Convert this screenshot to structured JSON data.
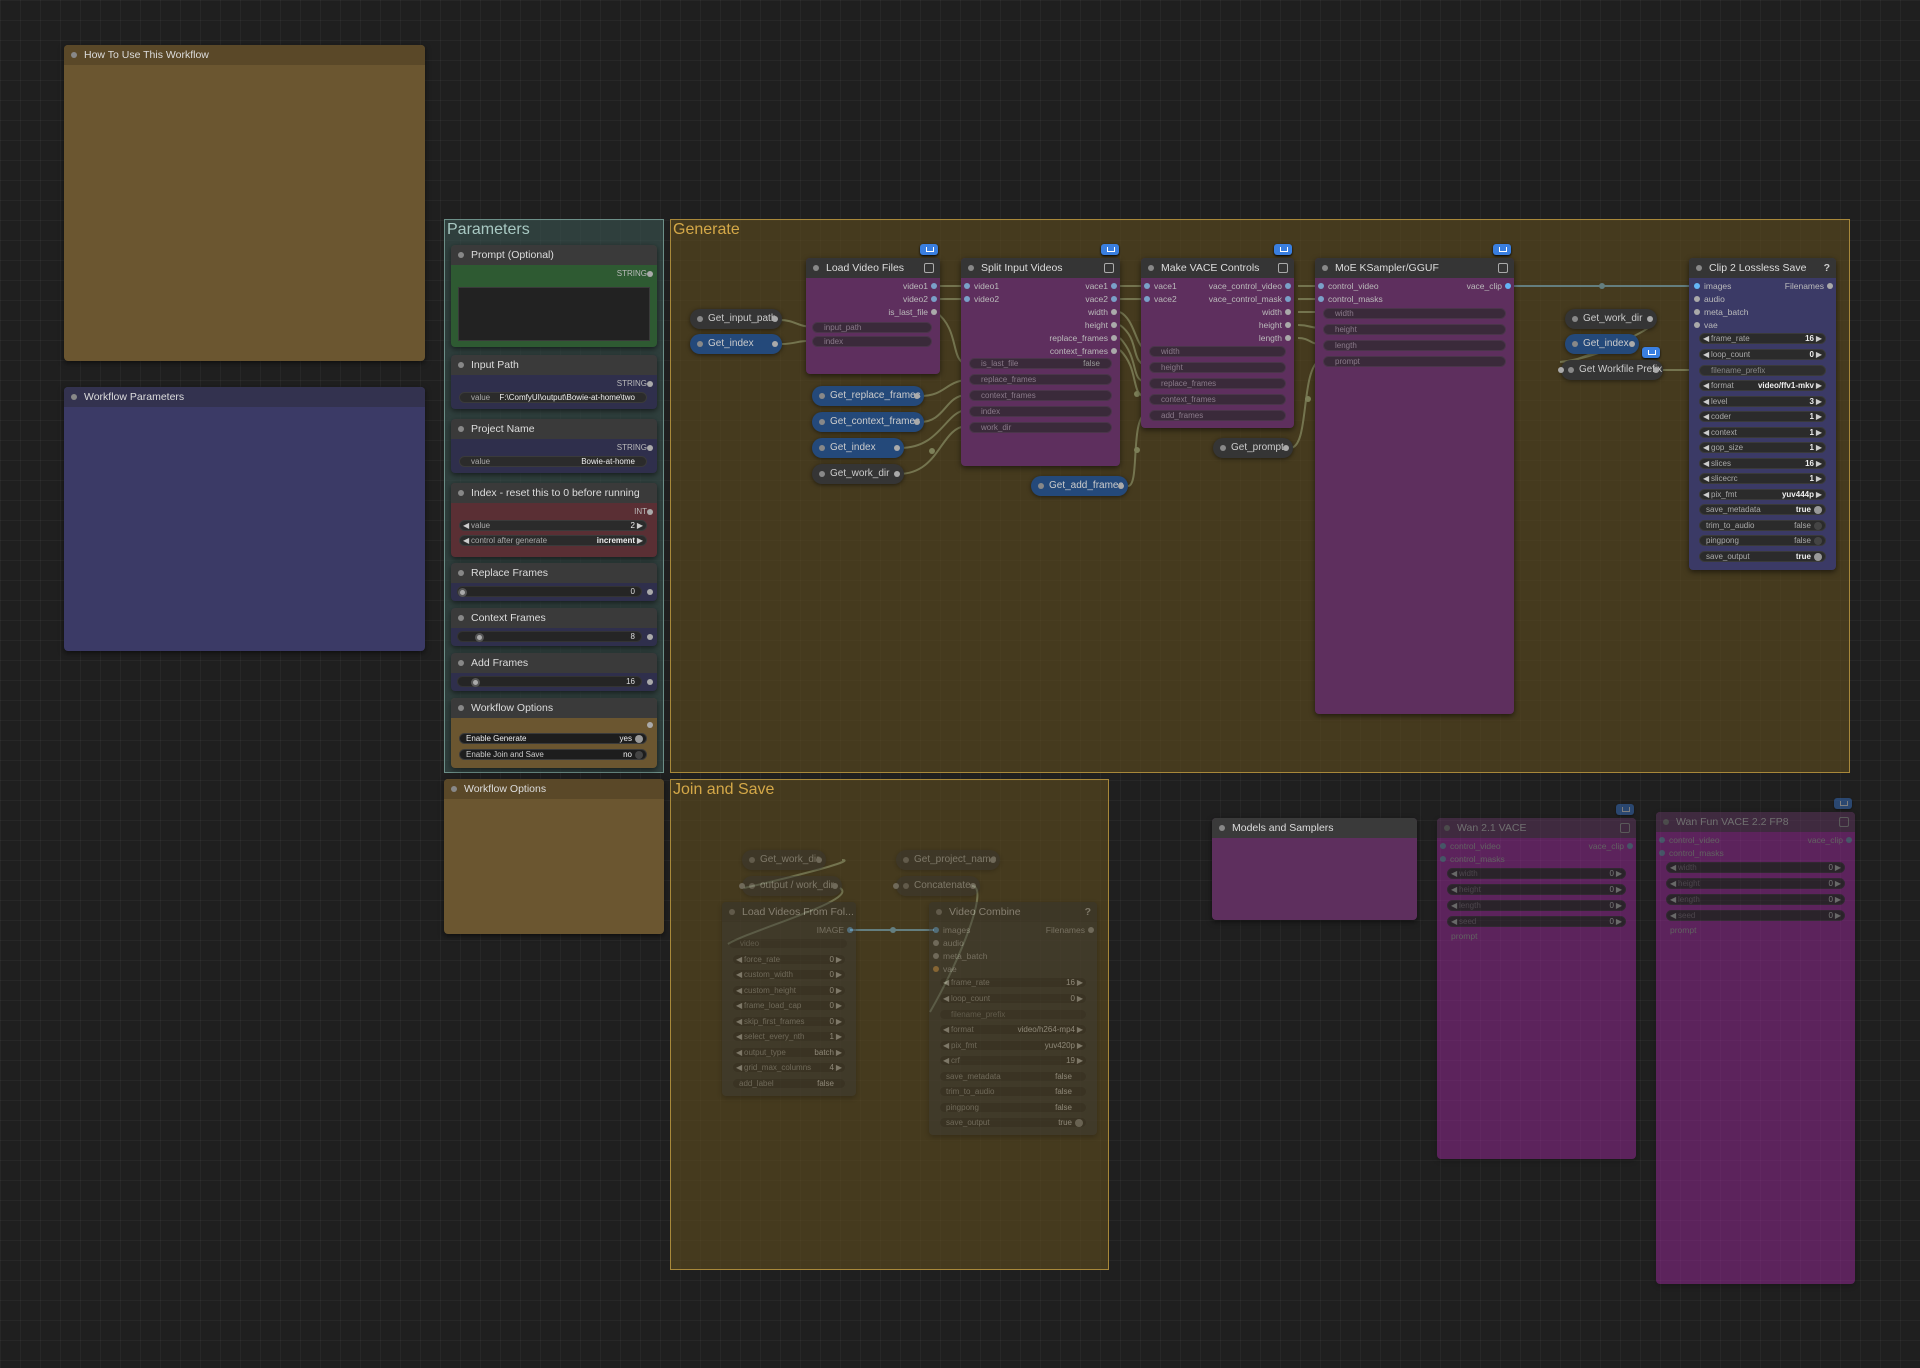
{
  "groups": {
    "parameters": "Parameters",
    "generate": "Generate",
    "join_and_save": "Join and Save"
  },
  "notes": {
    "how_to_use": "How To Use This Workflow",
    "workflow_parameters": "Workflow Parameters",
    "workflow_options_note": "Workflow Options",
    "models_and_samplers": "Models and Samplers"
  },
  "param_nodes": {
    "prompt": {
      "title": "Prompt (Optional)",
      "type": "STRING"
    },
    "input_path": {
      "title": "Input Path",
      "type": "STRING",
      "key": "value",
      "value": "F:\\ComfyUI\\output\\Bowie-at-home\\two"
    },
    "project_name": {
      "title": "Project Name",
      "type": "STRING",
      "key": "value",
      "value": "Bowie-at-home"
    },
    "index": {
      "title": "Index - reset this to 0 before running",
      "type": "INT",
      "key": "value",
      "value": "2",
      "control_key": "control after generate",
      "control_value": "increment"
    },
    "replace_frames": {
      "title": "Replace Frames",
      "value": "0",
      "fraction": 0.0
    },
    "context_frames": {
      "title": "Context Frames",
      "value": "8",
      "fraction": 0.1
    },
    "add_frames": {
      "title": "Add Frames",
      "value": "16",
      "fraction": 0.08
    },
    "workflow_options": {
      "title": "Workflow Options",
      "enable_generate": "Enable Generate",
      "enable_generate_value": "yes",
      "enable_join": "Enable Join and Save",
      "enable_join_value": "no"
    }
  },
  "get_nodes": {
    "input_path": "Get_input_path",
    "index": "Get_index",
    "replace_frames": "Get_replace_frames",
    "context_frames": "Get_context_frames",
    "index2": "Get_index",
    "work_dir": "Get_work_dir",
    "add_frames": "Get_add_frames",
    "prompt": "Get_prompt",
    "work_dir2": "Get_work_dir",
    "index3": "Get_index",
    "workfile_prefix": "Get Workfile Prefix",
    "work_dir3": "Get_work_dir",
    "project_name": "Get_project_name"
  },
  "load_video_files": {
    "title": "Load Video Files",
    "outputs": [
      "video1",
      "video2",
      "is_last_file"
    ],
    "inputs": [
      "input_path",
      "index"
    ]
  },
  "split_input_videos": {
    "title": "Split Input Videos",
    "inputs": [
      "video1",
      "video2"
    ],
    "outputs": [
      "vace1",
      "vace2",
      "width",
      "height",
      "replace_frames",
      "context_frames"
    ],
    "widgets": [
      {
        "k": "is_last_file",
        "v": "false"
      },
      {
        "k": "replace_frames",
        "v": ""
      },
      {
        "k": "context_frames",
        "v": ""
      },
      {
        "k": "index",
        "v": ""
      },
      {
        "k": "work_dir",
        "v": ""
      }
    ]
  },
  "make_vace_controls": {
    "title": "Make VACE Controls",
    "inputs": [
      "vace1",
      "vace2"
    ],
    "outputs": [
      "vace_control_video",
      "vace_control_mask",
      "width",
      "height",
      "length"
    ],
    "widgets": [
      "width",
      "height",
      "replace_frames",
      "context_frames",
      "add_frames"
    ]
  },
  "moe_ksampler": {
    "title": "MoE KSampler/GGUF",
    "inputs": [
      "control_video",
      "control_masks"
    ],
    "output": "vace_clip",
    "widgets": [
      "width",
      "height",
      "length",
      "prompt"
    ]
  },
  "clip_save": {
    "title": "Clip 2 Lossless Save",
    "help": "?",
    "inputs": [
      "images",
      "audio",
      "meta_batch",
      "vae"
    ],
    "output": "Filenames",
    "widgets": [
      {
        "k": "frame_rate",
        "v": "16",
        "arrows": true
      },
      {
        "k": "loop_count",
        "v": "0",
        "arrows": true
      },
      {
        "k": "filename_prefix",
        "v": "",
        "ghost": true
      },
      {
        "k": "format",
        "v": "video/ffv1-mkv",
        "arrows": true
      },
      {
        "k": "level",
        "v": "3",
        "arrows": true
      },
      {
        "k": "coder",
        "v": "1",
        "arrows": true
      },
      {
        "k": "context",
        "v": "1",
        "arrows": true
      },
      {
        "k": "gop_size",
        "v": "1",
        "arrows": true
      },
      {
        "k": "slices",
        "v": "16",
        "arrows": true
      },
      {
        "k": "slicecrc",
        "v": "1",
        "arrows": true
      },
      {
        "k": "pix_fmt",
        "v": "yuv444p",
        "arrows": true
      },
      {
        "k": "save_metadata",
        "v": "true",
        "toggle": "on"
      },
      {
        "k": "trim_to_audio",
        "v": "false",
        "toggle": "off"
      },
      {
        "k": "pingpong",
        "v": "false",
        "toggle": "off"
      },
      {
        "k": "save_output",
        "v": "true",
        "toggle": "on"
      }
    ]
  },
  "join_nodes": {
    "output_work_dir": "output / work_dir",
    "concatenate": "Concatenate",
    "load_videos": {
      "title": "Load Videos From Fol...",
      "output": "IMAGE",
      "input": "video",
      "widgets": [
        {
          "k": "force_rate",
          "v": "0"
        },
        {
          "k": "custom_width",
          "v": "0"
        },
        {
          "k": "custom_height",
          "v": "0"
        },
        {
          "k": "frame_load_cap",
          "v": "0"
        },
        {
          "k": "skip_first_frames",
          "v": "0"
        },
        {
          "k": "select_every_nth",
          "v": "1"
        },
        {
          "k": "output_type",
          "v": "batch"
        },
        {
          "k": "grid_max_columns",
          "v": "4"
        },
        {
          "k": "add_label",
          "v": "false"
        }
      ]
    },
    "video_combine": {
      "title": "Video Combine",
      "help": "?",
      "inputs": [
        "images",
        "audio",
        "meta_batch",
        "vae"
      ],
      "output": "Filenames",
      "widgets": [
        {
          "k": "frame_rate",
          "v": "16"
        },
        {
          "k": "loop_count",
          "v": "0"
        },
        {
          "k": "filename_prefix",
          "v": ""
        },
        {
          "k": "format",
          "v": "video/h264-mp4"
        },
        {
          "k": "pix_fmt",
          "v": "yuv420p"
        },
        {
          "k": "crf",
          "v": "19"
        },
        {
          "k": "save_metadata",
          "v": "false"
        },
        {
          "k": "trim_to_audio",
          "v": "false"
        },
        {
          "k": "pingpong",
          "v": "false"
        },
        {
          "k": "save_output",
          "v": "true"
        }
      ]
    }
  },
  "model_nodes": {
    "wan21": {
      "title": "Wan 2.1 VACE",
      "inputs": [
        "control_video",
        "control_masks"
      ],
      "output": "vace_clip",
      "widgets": [
        {
          "k": "width",
          "v": "0"
        },
        {
          "k": "height",
          "v": "0"
        },
        {
          "k": "length",
          "v": "0"
        },
        {
          "k": "seed",
          "v": "0"
        },
        {
          "k": "prompt",
          "v": ""
        }
      ]
    },
    "wanfun22": {
      "title": "Wan Fun VACE 2.2 FP8",
      "inputs": [
        "control_video",
        "control_masks"
      ],
      "output": "vace_clip",
      "widgets": [
        {
          "k": "width",
          "v": "0"
        },
        {
          "k": "height",
          "v": "0"
        },
        {
          "k": "length",
          "v": "0"
        },
        {
          "k": "seed",
          "v": "0"
        },
        {
          "k": "prompt",
          "v": ""
        }
      ]
    }
  },
  "colors": {
    "note_brown": "#6b5630",
    "note_blue": "#3b3a66",
    "purple_node": "#5e2f5e",
    "magenta_node": "#6b1d6b",
    "get_blue": "#24497a",
    "wire": "#9ab8a0",
    "image_wire": "#64b5f6"
  }
}
